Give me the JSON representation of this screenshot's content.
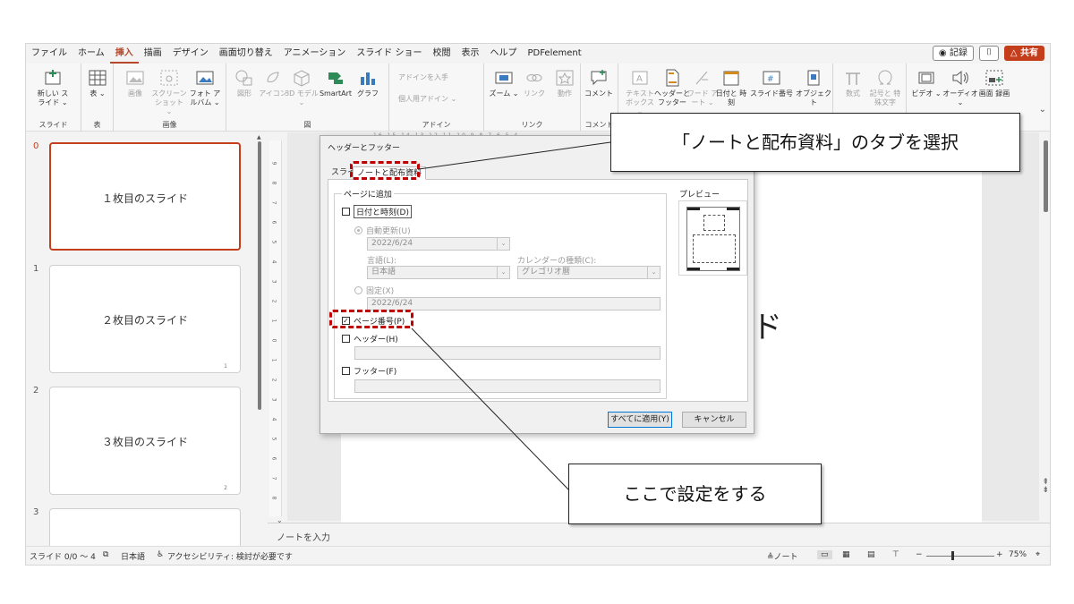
{
  "menubar": {
    "items": [
      "ファイル",
      "ホーム",
      "挿入",
      "描画",
      "デザイン",
      "画面切り替え",
      "アニメーション",
      "スライド ショー",
      "校閲",
      "表示",
      "ヘルプ",
      "PDFelement"
    ],
    "active_index": 2,
    "record": "◉ 記録",
    "share": "△ 共有"
  },
  "ribbon": {
    "new_slide": "新しい スライド ⌄",
    "table": "表 ⌄",
    "image": "画像",
    "screenshot": "スクリーン ショット ⌄",
    "photo_album": "フォト アルバム ⌄",
    "shapes": "図形",
    "icons": "アイコン",
    "models_3d": "3D モデル ⌄",
    "smartart": "SmartArt",
    "graph": "グラフ",
    "get_addins": "アドインを入手",
    "personal_addins": "個人用アドイン ⌄",
    "zoom": "ズーム ⌄",
    "link": "リンク",
    "action": "動作",
    "comment": "コメント",
    "textbox": "テキスト ボックス ⌄",
    "header_footer": "ヘッダーと フッター",
    "wordart": "ワード アート ⌄",
    "date_time": "日付と 時刻",
    "slide_number": "スライド番号",
    "object": "オブジェクト",
    "equation": "数式",
    "symbol": "記号と 特殊文字",
    "video": "ビデオ ⌄",
    "audio": "オーディオ ⌄",
    "screen_recording": "画面 録画",
    "groups": [
      "スライド",
      "表",
      "画像",
      "図",
      "アドイン",
      "リンク",
      "コメント"
    ]
  },
  "thumbnails": [
    {
      "num": "0",
      "title": "１枚目のスライド",
      "page": ""
    },
    {
      "num": "1",
      "title": "２枚目のスライド",
      "page": "1"
    },
    {
      "num": "2",
      "title": "３枚目のスライド",
      "page": "2"
    },
    {
      "num": "3",
      "title": "",
      "page": ""
    }
  ],
  "slide": {
    "visible_text": "イド"
  },
  "notes_placeholder": "ノートを入力",
  "statusbar": {
    "slide_info": "スライド 0/0 ～ 4",
    "language": "日本語",
    "accessibility": "アクセシビリティ: 検討が必要です",
    "notes": "≜ノート",
    "zoom": "75%"
  },
  "dialog": {
    "title": "ヘッダーとフッター",
    "tab_slide": "スライド",
    "tab_notes": "ノートと配布資料",
    "group_label": "ページに追加",
    "date_time": "日付と時刻(D)",
    "auto_update": "自動更新(U)",
    "auto_date": "2022/6/24",
    "language_label": "言語(L):",
    "language_value": "日本語",
    "calendar_label": "カレンダーの種類(C):",
    "calendar_value": "グレゴリオ暦",
    "fixed": "固定(X)",
    "fixed_date": "2022/6/24",
    "page_number": "ページ番号(P)",
    "header": "ヘッダー(H)",
    "footer": "フッター(F)",
    "preview": "プレビュー",
    "apply_all": "すべてに適用(Y)",
    "cancel": "キャンセル"
  },
  "annotations": {
    "top": "「ノートと配布資料」のタブを選択",
    "bottom": "ここで設定をする",
    "highlight_color": "#c00000"
  }
}
